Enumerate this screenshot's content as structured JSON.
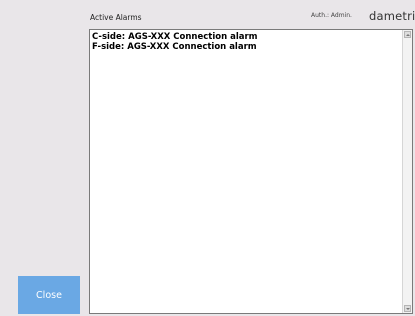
{
  "header": {
    "title": "Active Alarms",
    "auth": "Auth.: Admin.",
    "logo_text": "dametric"
  },
  "alarms": [
    "C-side: AGS-XXX Connection alarm",
    "F-side: AGS-XXX Connection alarm"
  ],
  "buttons": {
    "close_label": "Close"
  },
  "colors": {
    "background": "#e9e6e9",
    "close_button": "#6aa8e4",
    "list_background": "#ffffff"
  },
  "icons": {
    "scroll_up": "scroll-up-arrow-icon",
    "scroll_down": "scroll-down-arrow-icon"
  }
}
